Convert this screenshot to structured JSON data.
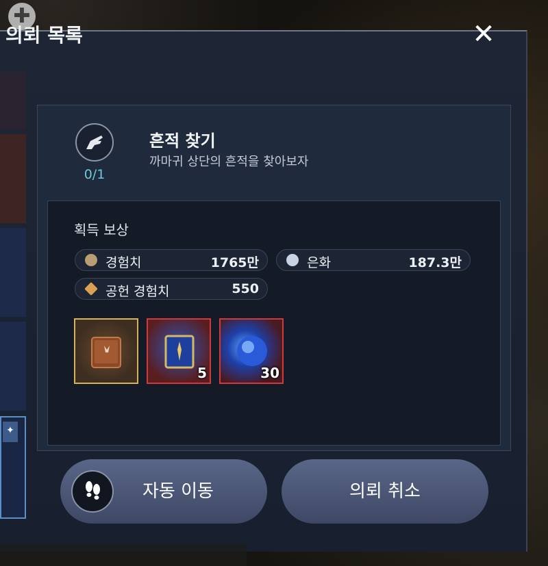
{
  "panel": {
    "title": "의뢰 목록",
    "close_icon": "close-icon"
  },
  "quest": {
    "icon": "hand-icon",
    "progress": "0/1",
    "title": "흔적 찾기",
    "description": "까마귀 상단의 흔적을 찾아보자"
  },
  "rewards": {
    "label": "획득 보상",
    "currencies": [
      {
        "icon": "exp-icon",
        "label": "경험치",
        "value": "1765만"
      },
      {
        "icon": "silver-icon",
        "label": "은화",
        "value": "187.3만"
      },
      {
        "icon": "contribution-icon",
        "label": "공헌 경험치",
        "value": "550"
      }
    ],
    "items": [
      {
        "icon": "book-icon",
        "quantity": "",
        "grade_color": "#d7b45a"
      },
      {
        "icon": "scroll-icon",
        "quantity": "5",
        "grade_color": "#d03a3a"
      },
      {
        "icon": "blue-orb-icon",
        "quantity": "30",
        "grade_color": "#d03a3a"
      }
    ]
  },
  "buttons": {
    "auto_move": {
      "label": "자동 이동",
      "icon": "footsteps-icon"
    },
    "cancel": {
      "label": "의뢰 취소"
    }
  }
}
